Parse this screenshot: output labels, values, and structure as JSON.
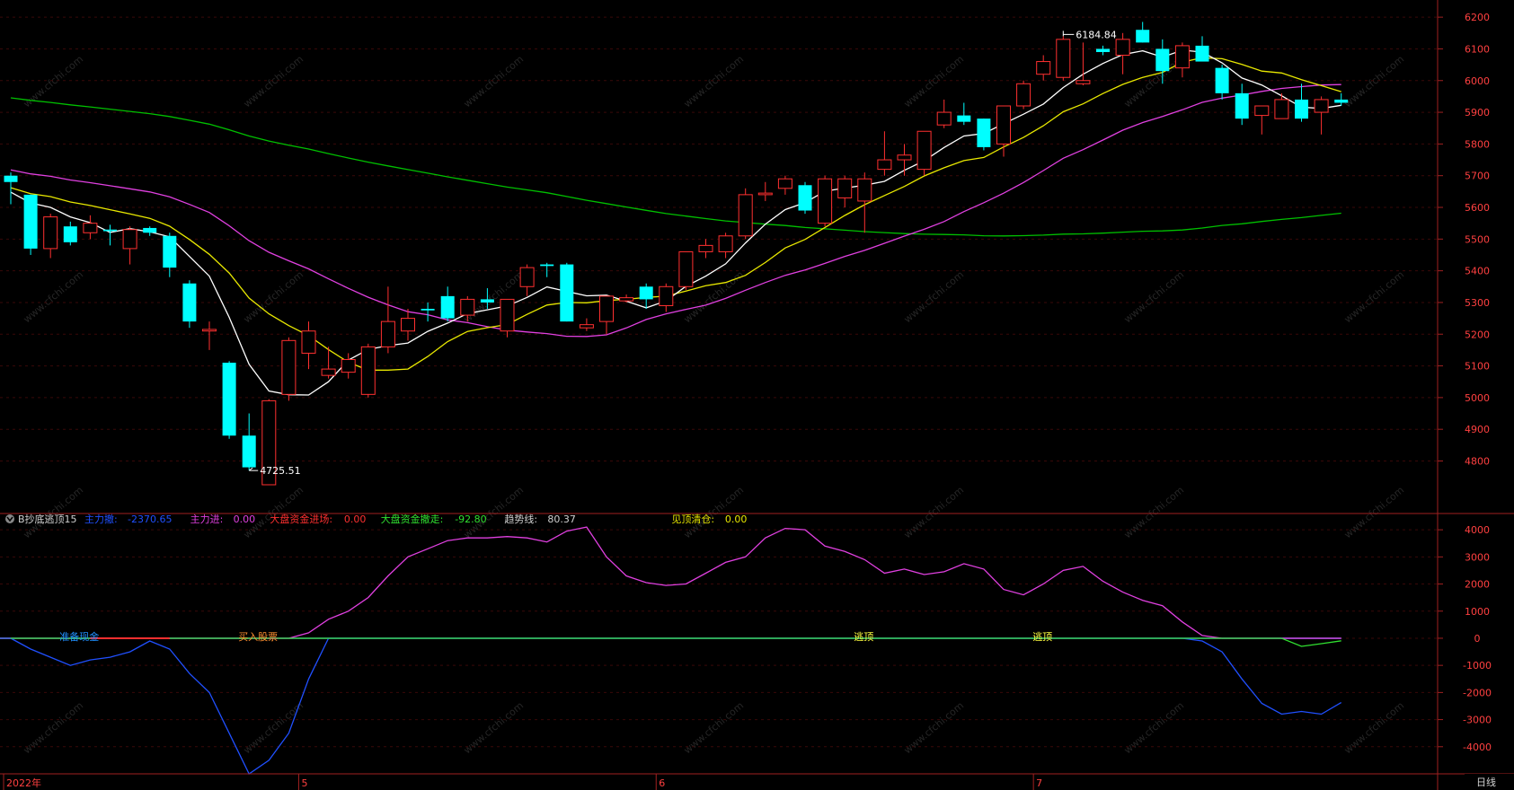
{
  "indicator": {
    "name": "B抄底逃顶15",
    "items": [
      {
        "label": "主力撤:",
        "value": "-2370.65",
        "color": "#2050ff"
      },
      {
        "label": "主力进:",
        "value": "0.00",
        "color": "#e040e0"
      },
      {
        "label": "大盘资金进场:",
        "value": "0.00",
        "color": "#ff3030"
      },
      {
        "label": "大盘资金撤走:",
        "value": "-92.80",
        "color": "#30e030"
      },
      {
        "label": "趋势线:",
        "value": "80.37",
        "color": "#d0d0d0"
      },
      {
        "label": "见顶清仓:",
        "value": "0.00",
        "color": "#e8e800"
      }
    ],
    "signals": [
      {
        "text": "准备现金",
        "idx": 3,
        "color": "#2090ff"
      },
      {
        "text": "买入股票",
        "idx": 12,
        "color": "#ff9030"
      },
      {
        "text": "逃顶",
        "idx": 43,
        "color": "#ffff40"
      },
      {
        "text": "逃顶",
        "idx": 52,
        "color": "#ffff40"
      }
    ]
  },
  "x_axis": {
    "labels": [
      {
        "text": "2022年",
        "idx": 0
      },
      {
        "text": "5",
        "idx": 15
      },
      {
        "text": "6",
        "idx": 33
      },
      {
        "text": "7",
        "idx": 52
      }
    ],
    "period": "日线"
  },
  "annotations": {
    "high": {
      "text": "6184.84",
      "idx": 53
    },
    "low": {
      "text": "4725.51",
      "idx": 12
    }
  },
  "watermark": "www.cfchi.com",
  "chart_data": [
    {
      "type": "candlestick",
      "ylim": [
        4640,
        6240
      ],
      "yticks": [
        4800,
        4900,
        5000,
        5100,
        5200,
        5300,
        5400,
        5500,
        5600,
        5700,
        5800,
        5900,
        6000,
        6100,
        6200
      ],
      "colors": {
        "up": "#ff3030",
        "down": "#00ffff",
        "ma5": "#ffffff",
        "ma10": "#e8e800",
        "ma20": "#e040e0",
        "ma60": "#00c000"
      },
      "candles": [
        {
          "o": 5700,
          "h": 5710,
          "l": 5610,
          "c": 5680
        },
        {
          "o": 5640,
          "h": 5640,
          "l": 5450,
          "c": 5470
        },
        {
          "o": 5470,
          "h": 5580,
          "l": 5440,
          "c": 5570
        },
        {
          "o": 5540,
          "h": 5555,
          "l": 5480,
          "c": 5490
        },
        {
          "o": 5520,
          "h": 5575,
          "l": 5500,
          "c": 5550
        },
        {
          "o": 5530,
          "h": 5545,
          "l": 5480,
          "c": 5525
        },
        {
          "o": 5470,
          "h": 5540,
          "l": 5420,
          "c": 5530
        },
        {
          "o": 5535,
          "h": 5540,
          "l": 5510,
          "c": 5520
        },
        {
          "o": 5510,
          "h": 5520,
          "l": 5380,
          "c": 5410
        },
        {
          "o": 5360,
          "h": 5370,
          "l": 5220,
          "c": 5240
        },
        {
          "o": 5210,
          "h": 5240,
          "l": 5150,
          "c": 5215
        },
        {
          "o": 5110,
          "h": 5115,
          "l": 4870,
          "c": 4880
        },
        {
          "o": 4880,
          "h": 4950,
          "l": 4770,
          "c": 4780
        },
        {
          "o": 4725,
          "h": 4995,
          "l": 4725,
          "c": 4990
        },
        {
          "o": 5010,
          "h": 5190,
          "l": 4990,
          "c": 5180
        },
        {
          "o": 5140,
          "h": 5240,
          "l": 5090,
          "c": 5210
        },
        {
          "o": 5070,
          "h": 5160,
          "l": 5060,
          "c": 5090
        },
        {
          "o": 5080,
          "h": 5140,
          "l": 5060,
          "c": 5120
        },
        {
          "o": 5010,
          "h": 5170,
          "l": 5000,
          "c": 5160
        },
        {
          "o": 5160,
          "h": 5350,
          "l": 5140,
          "c": 5240
        },
        {
          "o": 5210,
          "h": 5280,
          "l": 5180,
          "c": 5250
        },
        {
          "o": 5280,
          "h": 5300,
          "l": 5240,
          "c": 5275
        },
        {
          "o": 5320,
          "h": 5350,
          "l": 5240,
          "c": 5250
        },
        {
          "o": 5260,
          "h": 5320,
          "l": 5240,
          "c": 5310
        },
        {
          "o": 5310,
          "h": 5345,
          "l": 5280,
          "c": 5300
        },
        {
          "o": 5210,
          "h": 5300,
          "l": 5190,
          "c": 5310
        },
        {
          "o": 5350,
          "h": 5420,
          "l": 5320,
          "c": 5410
        },
        {
          "o": 5420,
          "h": 5425,
          "l": 5380,
          "c": 5415
        },
        {
          "o": 5420,
          "h": 5425,
          "l": 5240,
          "c": 5240
        },
        {
          "o": 5220,
          "h": 5250,
          "l": 5210,
          "c": 5230
        },
        {
          "o": 5240,
          "h": 5320,
          "l": 5200,
          "c": 5320
        },
        {
          "o": 5305,
          "h": 5325,
          "l": 5300,
          "c": 5315
        },
        {
          "o": 5350,
          "h": 5360,
          "l": 5280,
          "c": 5310
        },
        {
          "o": 5290,
          "h": 5360,
          "l": 5270,
          "c": 5350
        },
        {
          "o": 5350,
          "h": 5450,
          "l": 5340,
          "c": 5460
        },
        {
          "o": 5460,
          "h": 5500,
          "l": 5440,
          "c": 5480
        },
        {
          "o": 5460,
          "h": 5520,
          "l": 5440,
          "c": 5510
        },
        {
          "o": 5510,
          "h": 5660,
          "l": 5500,
          "c": 5640
        },
        {
          "o": 5640,
          "h": 5680,
          "l": 5620,
          "c": 5645
        },
        {
          "o": 5660,
          "h": 5700,
          "l": 5640,
          "c": 5690
        },
        {
          "o": 5670,
          "h": 5680,
          "l": 5580,
          "c": 5590
        },
        {
          "o": 5550,
          "h": 5700,
          "l": 5540,
          "c": 5690
        },
        {
          "o": 5630,
          "h": 5700,
          "l": 5600,
          "c": 5690
        },
        {
          "o": 5620,
          "h": 5710,
          "l": 5520,
          "c": 5690
        },
        {
          "o": 5720,
          "h": 5840,
          "l": 5700,
          "c": 5750
        },
        {
          "o": 5750,
          "h": 5800,
          "l": 5700,
          "c": 5765
        },
        {
          "o": 5720,
          "h": 5840,
          "l": 5700,
          "c": 5840
        },
        {
          "o": 5860,
          "h": 5940,
          "l": 5850,
          "c": 5900
        },
        {
          "o": 5890,
          "h": 5930,
          "l": 5860,
          "c": 5870
        },
        {
          "o": 5880,
          "h": 5880,
          "l": 5780,
          "c": 5790
        },
        {
          "o": 5800,
          "h": 5920,
          "l": 5760,
          "c": 5920
        },
        {
          "o": 5920,
          "h": 6000,
          "l": 5910,
          "c": 5990
        },
        {
          "o": 6020,
          "h": 6080,
          "l": 6000,
          "c": 6060
        },
        {
          "o": 6010,
          "h": 6140,
          "l": 6000,
          "c": 6130
        },
        {
          "o": 5990,
          "h": 6120,
          "l": 5985,
          "c": 6000
        },
        {
          "o": 6100,
          "h": 6110,
          "l": 6080,
          "c": 6090
        },
        {
          "o": 6080,
          "h": 6150,
          "l": 6020,
          "c": 6130
        },
        {
          "o": 6160,
          "h": 6185,
          "l": 6120,
          "c": 6120
        },
        {
          "o": 6100,
          "h": 6130,
          "l": 5990,
          "c": 6030
        },
        {
          "o": 6040,
          "h": 6120,
          "l": 6010,
          "c": 6110
        },
        {
          "o": 6110,
          "h": 6140,
          "l": 6070,
          "c": 6060
        },
        {
          "o": 6040,
          "h": 6050,
          "l": 5940,
          "c": 5960
        },
        {
          "o": 5960,
          "h": 5990,
          "l": 5860,
          "c": 5880
        },
        {
          "o": 5890,
          "h": 5920,
          "l": 5830,
          "c": 5920
        },
        {
          "o": 5880,
          "h": 5960,
          "l": 5880,
          "c": 5940
        },
        {
          "o": 5940,
          "h": 5990,
          "l": 5870,
          "c": 5880
        },
        {
          "o": 5900,
          "h": 5950,
          "l": 5830,
          "c": 5940
        },
        {
          "o": 5940,
          "h": 5960,
          "l": 5920,
          "c": 5930
        }
      ]
    },
    {
      "type": "line",
      "ylim": [
        -5000,
        4600
      ],
      "yticks": [
        4000,
        3000,
        2000,
        1000,
        0,
        -1000,
        -2000,
        -3000,
        -4000
      ],
      "series": [
        {
          "name": "主力进",
          "color": "#e040e0",
          "values": [
            0,
            0,
            0,
            0,
            0,
            0,
            0,
            0,
            0,
            0,
            0,
            0,
            0,
            0,
            0,
            200,
            700,
            1000,
            1500,
            2300,
            3000,
            3300,
            3600,
            3700,
            3700,
            3750,
            3700,
            3550,
            3950,
            4100,
            3000,
            2300,
            2050,
            1950,
            2000,
            2400,
            2800,
            3000,
            3700,
            4050,
            4000,
            3400,
            3200,
            2900,
            2400,
            2550,
            2350,
            2450,
            2750,
            2550,
            1800,
            1600,
            2000,
            2500,
            2650,
            2100,
            1700,
            1400,
            1200,
            600,
            100,
            0,
            0,
            0,
            0,
            0,
            0,
            0
          ]
        },
        {
          "name": "主力撤",
          "color": "#2050ff",
          "values": [
            0,
            -400,
            -700,
            -1000,
            -800,
            -700,
            -500,
            -100,
            -400,
            -1300,
            -2000,
            -3500,
            -5000,
            -4500,
            -3500,
            -1500,
            0,
            0,
            0,
            0,
            0,
            0,
            0,
            0,
            0,
            0,
            0,
            0,
            0,
            0,
            0,
            0,
            0,
            0,
            0,
            0,
            0,
            0,
            0,
            0,
            0,
            0,
            0,
            0,
            0,
            0,
            0,
            0,
            0,
            0,
            0,
            0,
            0,
            0,
            0,
            0,
            0,
            0,
            0,
            0,
            -100,
            -500,
            -1500,
            -2400,
            -2800,
            -2700,
            -2800,
            -2370.65
          ]
        },
        {
          "name": "大盘资金撤走",
          "color": "#30e030",
          "values": [
            0,
            0,
            0,
            0,
            0,
            0,
            0,
            0,
            0,
            0,
            0,
            0,
            0,
            0,
            0,
            0,
            0,
            0,
            0,
            0,
            0,
            0,
            0,
            0,
            0,
            0,
            0,
            0,
            0,
            0,
            0,
            0,
            0,
            0,
            0,
            0,
            0,
            0,
            0,
            0,
            0,
            0,
            0,
            0,
            0,
            0,
            0,
            0,
            0,
            0,
            0,
            0,
            0,
            0,
            0,
            0,
            0,
            0,
            0,
            0,
            0,
            0,
            0,
            0,
            0,
            -300,
            -200,
            -92.8
          ]
        }
      ]
    }
  ]
}
